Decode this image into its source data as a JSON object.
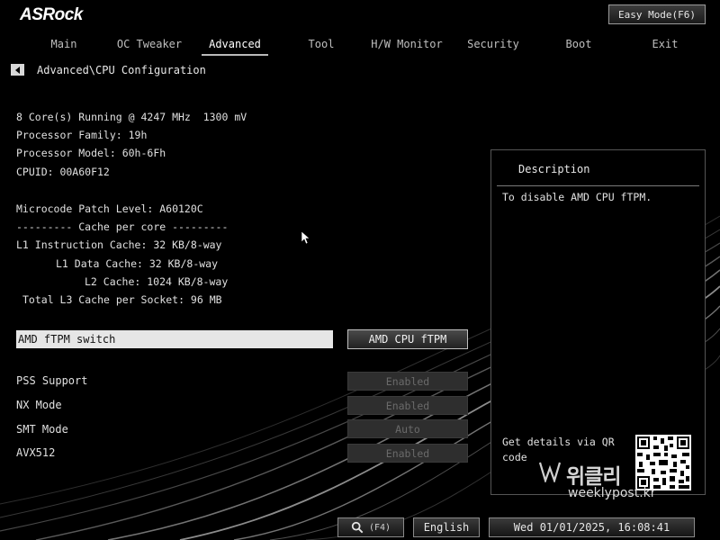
{
  "brand": {
    "logo_text": "ASRock"
  },
  "header": {
    "easy_mode_label": "Easy Mode(F6)"
  },
  "tabs": [
    {
      "label": "Main",
      "active": false
    },
    {
      "label": "OC Tweaker",
      "active": false
    },
    {
      "label": "Advanced",
      "active": true
    },
    {
      "label": "Tool",
      "active": false
    },
    {
      "label": "H/W Monitor",
      "active": false
    },
    {
      "label": "Security",
      "active": false
    },
    {
      "label": "Boot",
      "active": false
    },
    {
      "label": "Exit",
      "active": false
    }
  ],
  "breadcrumb": {
    "path": "Advanced\\CPU Configuration"
  },
  "cpu_info": {
    "running": "8 Core(s) Running @ 4247 MHz  1300 mV",
    "family": "Processor Family: 19h",
    "model": "Processor Model: 60h-6Fh",
    "cpuid": "CPUID: 00A60F12",
    "microcode": "Microcode Patch Level: A60120C",
    "cache_header": "--------- Cache per core ---------",
    "l1i": "L1 Instruction Cache: 32 KB/8-way",
    "l1d": "L1 Data Cache: 32 KB/8-way",
    "l2": "L2 Cache: 1024 KB/8-way",
    "l3": "Total L3 Cache per Socket: 96 MB"
  },
  "settings": {
    "ftpm": {
      "label": "AMD fTPM switch",
      "value": "AMD CPU fTPM"
    },
    "pss": {
      "label": "PSS Support",
      "value": "Enabled"
    },
    "nx": {
      "label": "NX Mode",
      "value": "Enabled"
    },
    "smt": {
      "label": "SMT Mode",
      "value": "Auto"
    },
    "avx512": {
      "label": "AVX512",
      "value": "Enabled"
    }
  },
  "description": {
    "title": "Description",
    "text": "To disable AMD CPU fTPM.",
    "qr_caption": "Get details via QR code"
  },
  "watermark": {
    "korean": "위클리",
    "site": "weeklypost.kr"
  },
  "footer": {
    "search_key": "(F4)",
    "language": "English",
    "datetime": "Wed 01/01/2025, 16:08:41"
  }
}
